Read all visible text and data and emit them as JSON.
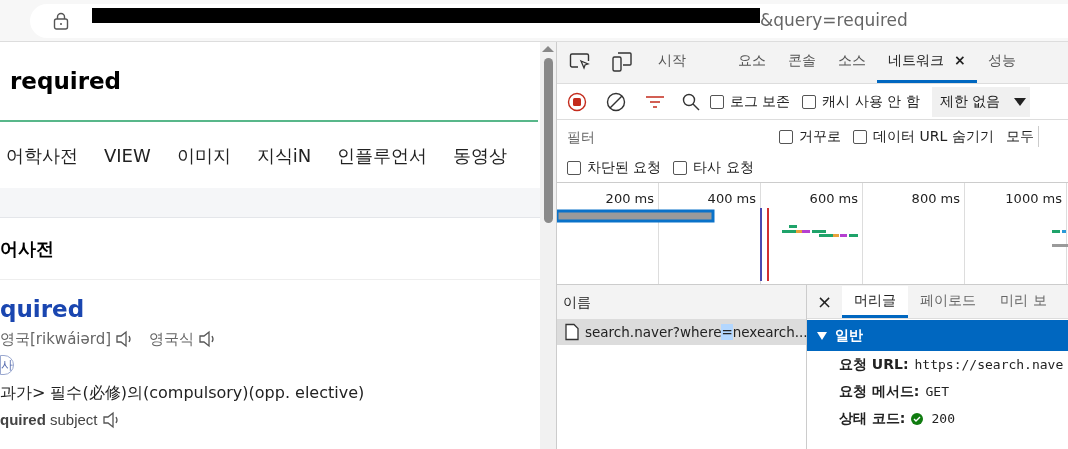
{
  "address_bar": {
    "url_visible": "&query=required"
  },
  "page": {
    "query": "required",
    "nav_tabs": [
      {
        "label": "어학사전",
        "selected": false
      },
      {
        "label": "VIEW",
        "selected": false
      },
      {
        "label": "이미지",
        "selected": false
      },
      {
        "label": "지식iN",
        "selected": false
      },
      {
        "label": "인플루언서",
        "selected": false
      },
      {
        "label": "동영상",
        "selected": false
      }
    ],
    "section_title": "어사전",
    "entry": {
      "word": "quired",
      "pronunciations": [
        {
          "label": "영국[rikwáiərd]"
        },
        {
          "label": "영국식"
        }
      ],
      "part_of_speech": "사",
      "definition": "과가> 필수(必修)의(compulsory)(opp. elective)",
      "example": "**quired** subject"
    }
  },
  "devtools": {
    "tabs": [
      {
        "label": "시작",
        "selected": false
      },
      {
        "label": "요소",
        "selected": false
      },
      {
        "label": "콘솔",
        "selected": false
      },
      {
        "label": "소스",
        "selected": false
      },
      {
        "label": "네트워크",
        "selected": true,
        "close_label": "×"
      },
      {
        "label": "성능",
        "selected": false
      }
    ],
    "toolbar": {
      "recording": true,
      "filter_open": true,
      "checkboxes": [
        {
          "label": "로그 보존",
          "checked": false
        },
        {
          "label": "캐시 사용 안 함",
          "checked": false
        }
      ],
      "throttle": "제한 없음"
    },
    "filter": {
      "placeholder": "필터",
      "checkboxes": [
        {
          "label": "거꾸로",
          "checked": false
        },
        {
          "label": "데이터 URL 숨기기",
          "checked": false
        }
      ],
      "type_button": "모두"
    },
    "filter_row2": [
      {
        "label": "차단된 요청",
        "checked": false
      },
      {
        "label": "타사 요청",
        "checked": false
      }
    ],
    "timeline_ticks": [
      "200 ms",
      "400 ms",
      "600 ms",
      "800 ms",
      "1000 ms"
    ],
    "requests": {
      "header": "이름",
      "rows": [
        {
          "before": "search.naver?where",
          "match": "=",
          "after": "nexearch...",
          "selected": true
        }
      ]
    },
    "details": {
      "close_label": "×",
      "tabs": [
        {
          "label": "머리글",
          "selected": true
        },
        {
          "label": "페이로드",
          "selected": false
        },
        {
          "label": "미리 보",
          "selected": false
        }
      ],
      "section": {
        "title": "일반",
        "expanded": true,
        "rows": [
          {
            "key": "요청 URL:",
            "value": "https://search.nave",
            "kind": "text"
          },
          {
            "key": "요청 메서드:",
            "value": "GET",
            "kind": "text"
          },
          {
            "key": "상태 코드:",
            "value": "200",
            "kind": "status"
          }
        ]
      }
    }
  }
}
